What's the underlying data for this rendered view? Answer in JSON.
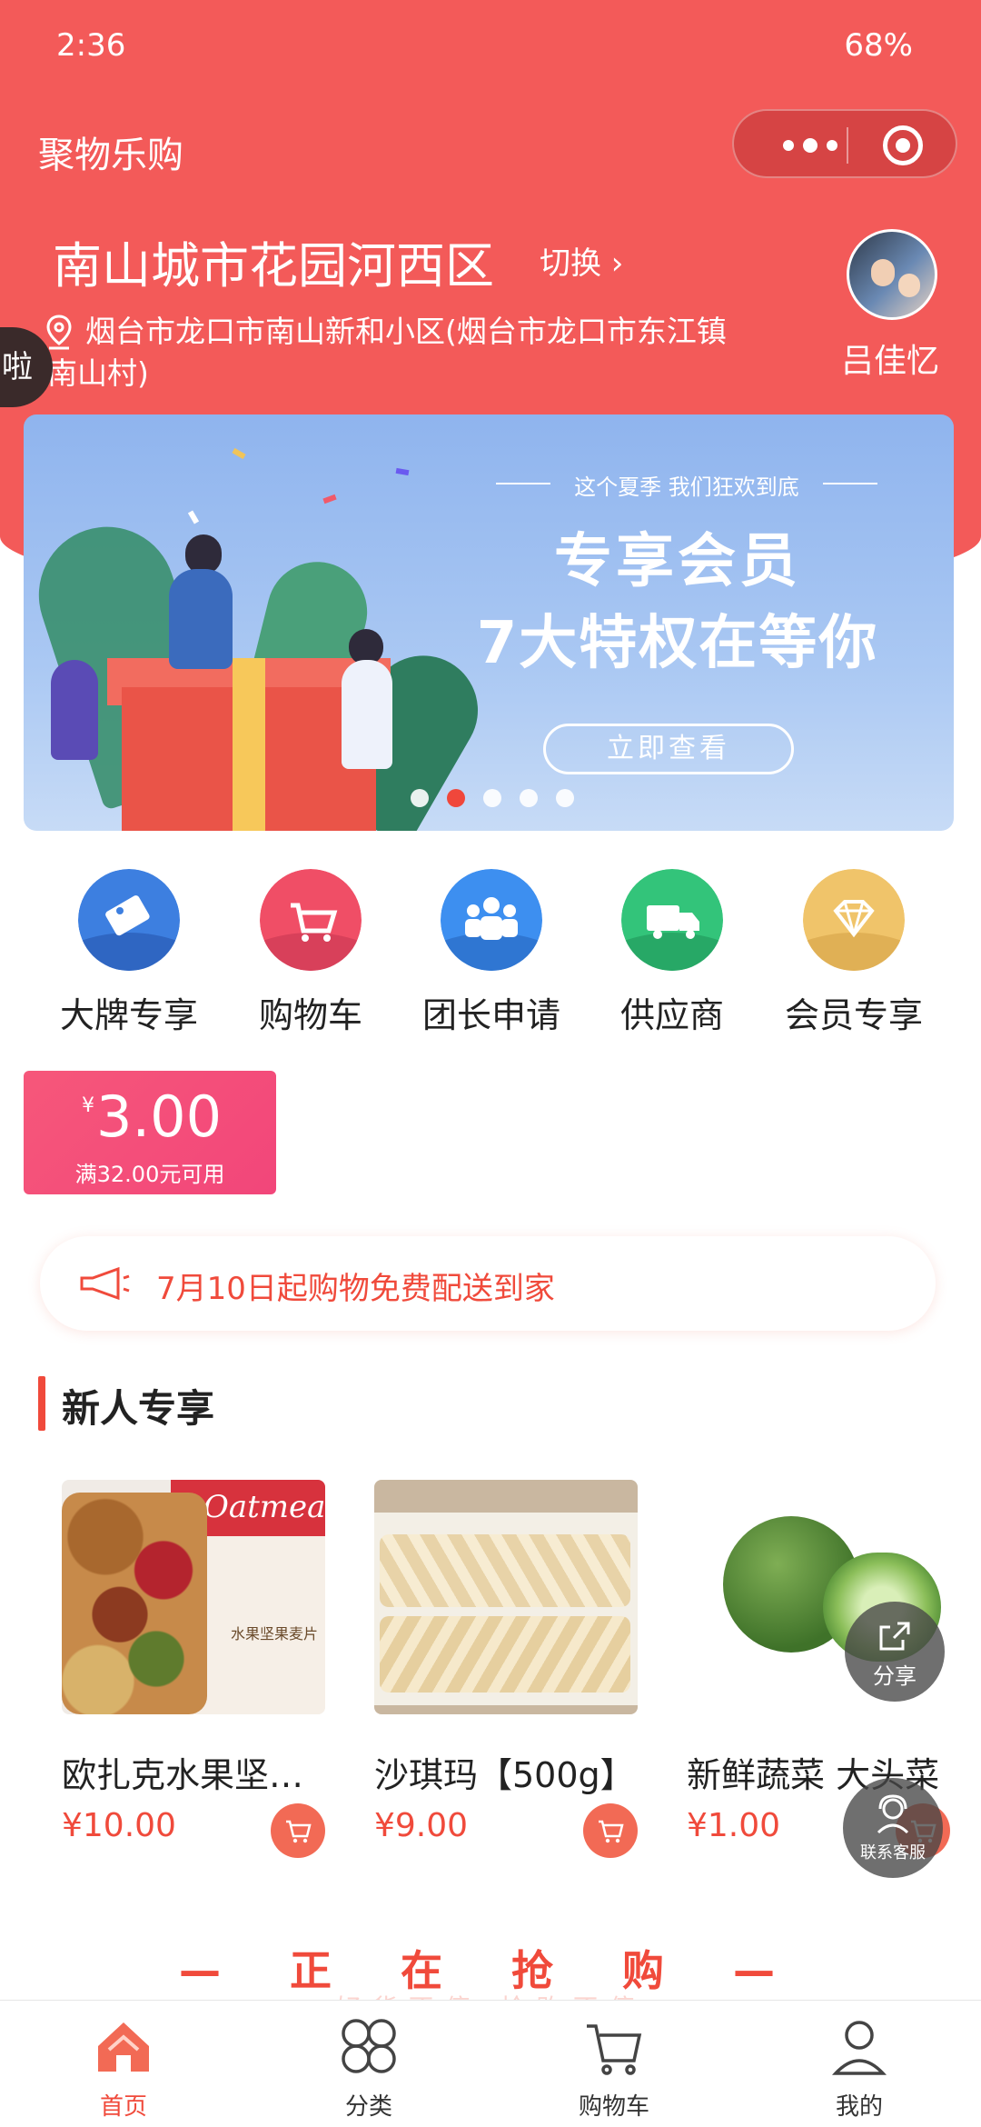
{
  "status_bar": {
    "time": "2:36",
    "battery": "68%"
  },
  "app": {
    "title": "聚物乐购"
  },
  "header": {
    "community": "南山城市花园河西区",
    "switch_label": "切换",
    "address": "烟台市龙口市南山新和小区(烟台市龙口市东江镇南山村)",
    "user_name": "吕佳忆",
    "side_tab_char": "啦"
  },
  "banner": {
    "subtitle": "这个夏季 我们狂欢到底",
    "title_line1": "专享会员",
    "title_line2": "7大特权在等你",
    "button_label": "立即查看",
    "dot_count": 5,
    "active_dot": 1
  },
  "quick_menu": [
    {
      "label": "大牌专享",
      "icon": "tag-icon",
      "color": "#3d7fe0"
    },
    {
      "label": "购物车",
      "icon": "cart-icon",
      "color": "#f04e66"
    },
    {
      "label": "团长申请",
      "icon": "group-icon",
      "color": "#3d8ff0"
    },
    {
      "label": "供应商",
      "icon": "truck-icon",
      "color": "#33c47a"
    },
    {
      "label": "会员专享",
      "icon": "diamond-icon",
      "color": "#f0c46a"
    }
  ],
  "coupon": {
    "currency": "¥",
    "amount": "3.00",
    "condition": "满32.00元可用"
  },
  "notice": {
    "text": "7月10日起购物免费配送到家"
  },
  "new_user": {
    "title": "新人专享",
    "products": [
      {
        "name": "欧扎克水果坚果麦片",
        "price": "¥10.00",
        "pack_text": "Oatmeal",
        "pack_label": "水果坚果麦片"
      },
      {
        "name": "沙琪玛【500g】",
        "price": "¥9.00"
      },
      {
        "name": "新鲜蔬菜 大头菜",
        "price": "¥1.00"
      }
    ]
  },
  "floating": {
    "share_label": "分享",
    "service_label": "联系客服"
  },
  "flash_sale": {
    "title": "— 正 在 抢 购 —",
    "subtitle": "好货不停 抢购不停"
  },
  "tabbar": [
    {
      "label": "首页",
      "icon": "home-icon",
      "active": true
    },
    {
      "label": "分类",
      "icon": "category-icon",
      "active": false
    },
    {
      "label": "购物车",
      "icon": "cart-icon",
      "active": false
    },
    {
      "label": "我的",
      "icon": "user-icon",
      "active": false
    }
  ],
  "colors": {
    "primary": "#f35a59",
    "accent": "#f04a3b",
    "coupon": "#f2467a"
  }
}
